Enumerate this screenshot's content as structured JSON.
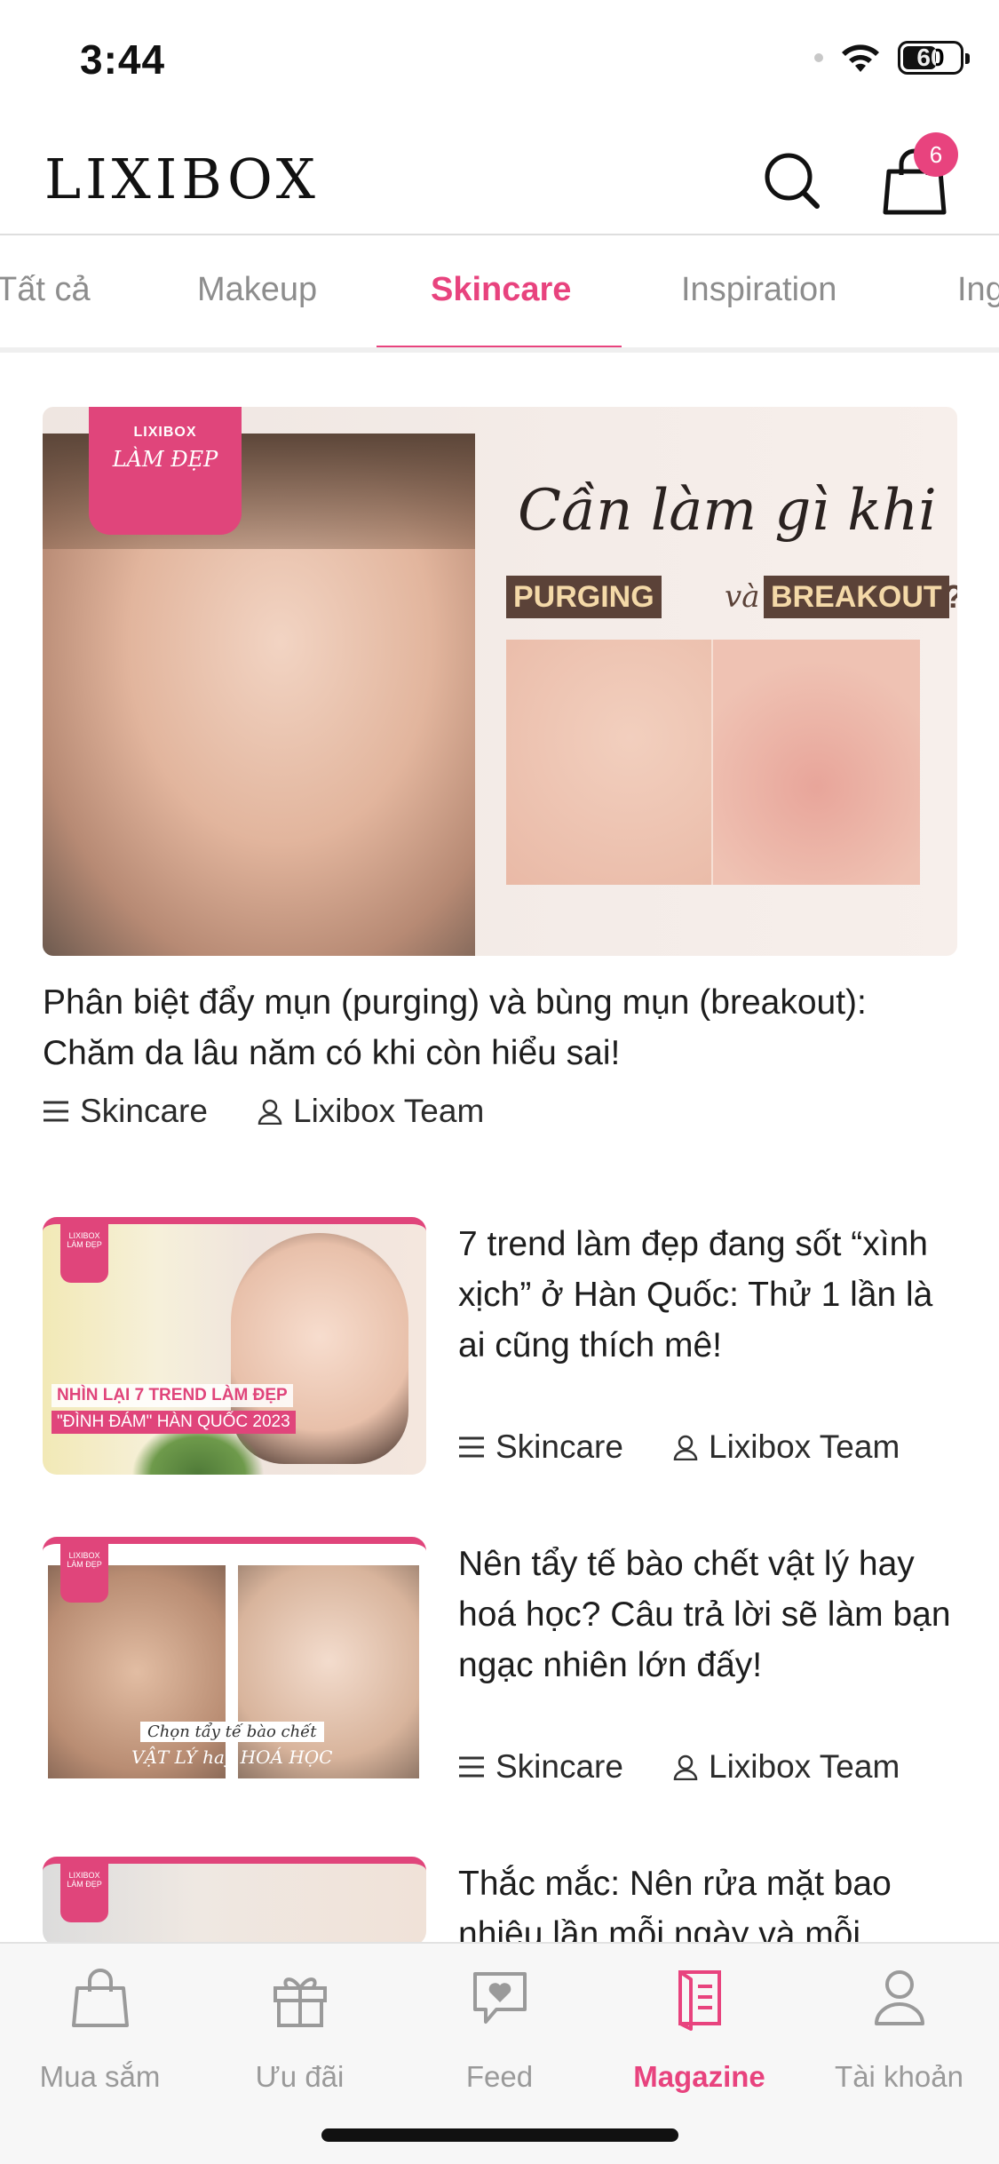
{
  "status_bar": {
    "time": "3:44",
    "battery": "60",
    "battery_level": 0.6
  },
  "header": {
    "logo": "LIXIBOX",
    "cart_count": "6"
  },
  "tabs": [
    {
      "label": "Tất cả"
    },
    {
      "label": "Makeup"
    },
    {
      "label": "Skincare"
    },
    {
      "label": "Inspiration"
    },
    {
      "label": "Ing"
    }
  ],
  "active_tab": "Skincare",
  "featured": {
    "badge_brand": "LIXIBOX",
    "badge_text": "LÀM ĐẸP",
    "image_headline": "Cần làm gì khi",
    "image_tag_1": "PURGING",
    "image_connector": "và",
    "image_tag_2": "BREAKOUT",
    "image_question": "?",
    "title": "Phân biệt đẩy mụn (purging) và bùng mụn (breakout): Chăm da lâu năm có khi còn hiểu sai!",
    "category": "Skincare",
    "author": "Lixibox Team"
  },
  "articles": [
    {
      "title": "7 trend làm đẹp đang sốt “xình xịch” ở Hàn Quốc: Thử 1 lần là ai cũng thích mê!",
      "category": "Skincare",
      "author": "Lixibox Team",
      "thumb_caption_1": "NHÌN LẠI 7 TREND LÀM ĐẸP",
      "thumb_caption_2": "\"ĐÌNH ĐÁM\" HÀN QUỐC 2023",
      "thumb_badge": "LIXIBOX LÀM ĐẸP"
    },
    {
      "title": "Nên tẩy tế bào chết vật lý hay hoá học? Câu trả lời sẽ làm bạn ngạc nhiên lớn đấy!",
      "category": "Skincare",
      "author": "Lixibox Team",
      "thumb_caption_1": "Chọn tẩy tế bào chết",
      "thumb_caption_2": "VẬT LÝ hay HOÁ HỌC",
      "thumb_badge": "LIXIBOX LÀM ĐẸP"
    },
    {
      "title": "Thắc mắc: Nên rửa mặt bao nhiêu lần mỗi ngày và mỗi",
      "thumb_badge": "LIXIBOX LÀM ĐẸP"
    }
  ],
  "bottom_nav": [
    {
      "label": "Mua sắm",
      "icon": "shopping-bag-icon"
    },
    {
      "label": "Ưu đãi",
      "icon": "gift-icon"
    },
    {
      "label": "Feed",
      "icon": "chat-heart-icon"
    },
    {
      "label": "Magazine",
      "icon": "magazine-icon"
    },
    {
      "label": "Tài khoản",
      "icon": "user-icon"
    }
  ],
  "active_nav": "Magazine",
  "colors": {
    "accent": "#e8437e",
    "badge_pink": "#e0457b",
    "inactive": "#8d8d8d"
  }
}
